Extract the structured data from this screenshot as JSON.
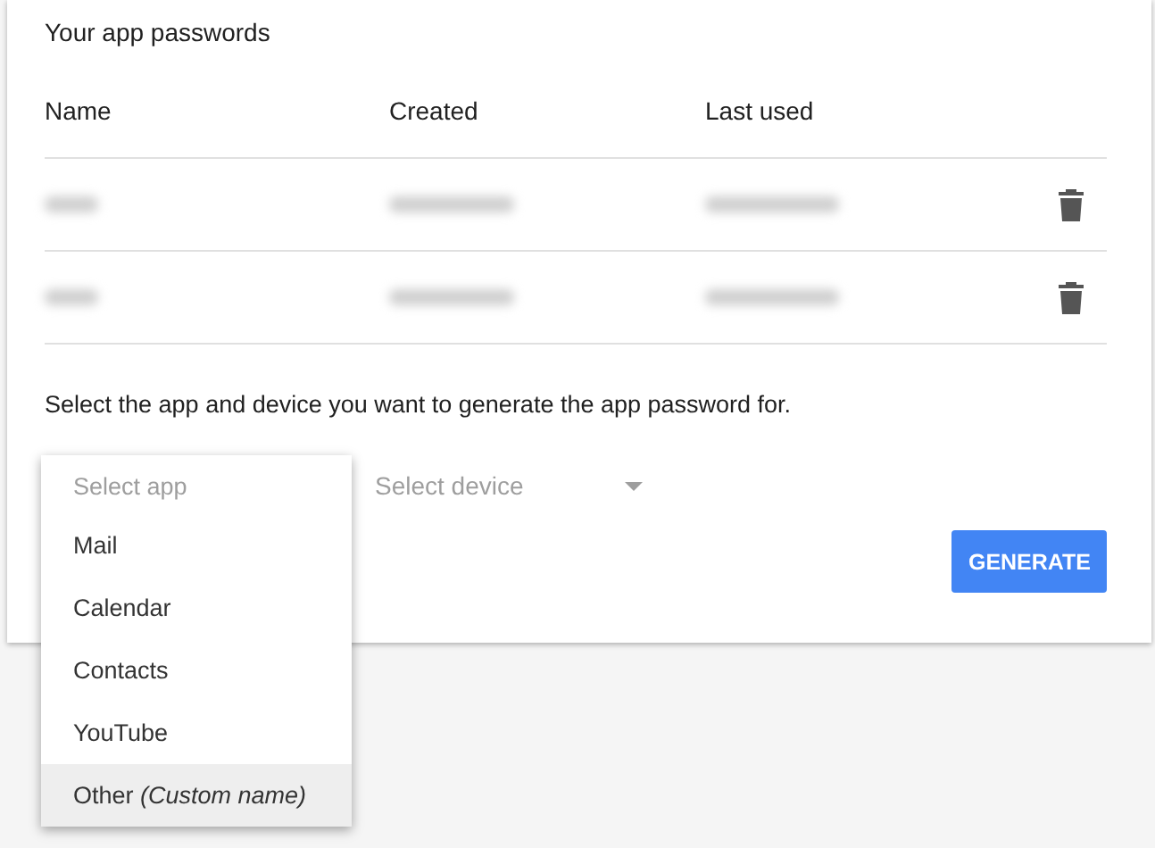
{
  "title": "Your app passwords",
  "table": {
    "columns": [
      "Name",
      "Created",
      "Last used"
    ],
    "rows": [
      {
        "redacted": true
      },
      {
        "redacted": true
      }
    ]
  },
  "prompt": "Select the app and device you want to generate the app password for.",
  "app_select": {
    "placeholder": "Select app",
    "expanded": true,
    "options": [
      {
        "label": "Mail",
        "selected": false
      },
      {
        "label": "Calendar",
        "selected": false
      },
      {
        "label": "Contacts",
        "selected": false
      },
      {
        "label": "YouTube",
        "selected": false
      },
      {
        "label": "Other *(Custom name)*",
        "selected": true
      }
    ]
  },
  "device_select": {
    "placeholder": "Select device"
  },
  "generate_button": "GENERATE"
}
